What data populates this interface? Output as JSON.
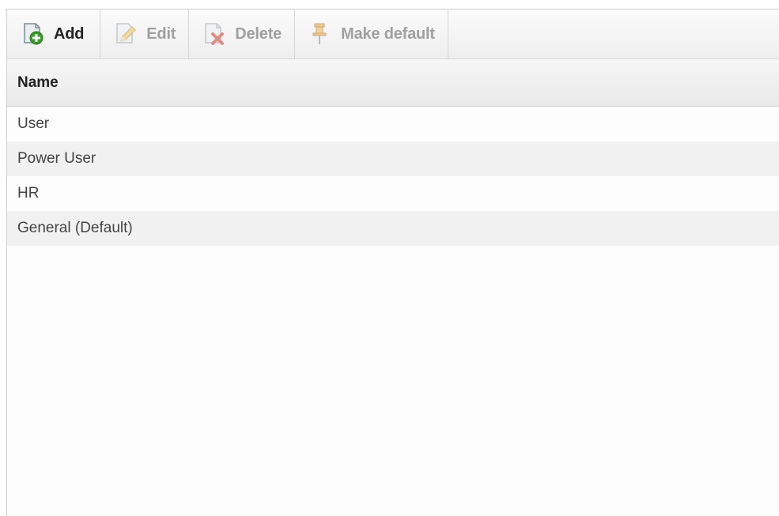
{
  "toolbar": {
    "buttons": [
      {
        "label": "Add",
        "icon": "add-page-icon",
        "enabled": true
      },
      {
        "label": "Edit",
        "icon": "edit-pencil-icon",
        "enabled": false
      },
      {
        "label": "Delete",
        "icon": "delete-page-icon",
        "enabled": false
      },
      {
        "label": "Make default",
        "icon": "pin-icon",
        "enabled": false
      }
    ]
  },
  "grid": {
    "column_header": "Name",
    "rows": [
      {
        "name": "User"
      },
      {
        "name": "Power User"
      },
      {
        "name": "HR"
      },
      {
        "name": "General (Default)"
      }
    ]
  },
  "colors": {
    "add_icon_green": "#3a9a2a",
    "delete_icon_red": "#d33a2a",
    "pin_icon_orange": "#e8a23a",
    "alt_row": "#f1f1f1"
  }
}
